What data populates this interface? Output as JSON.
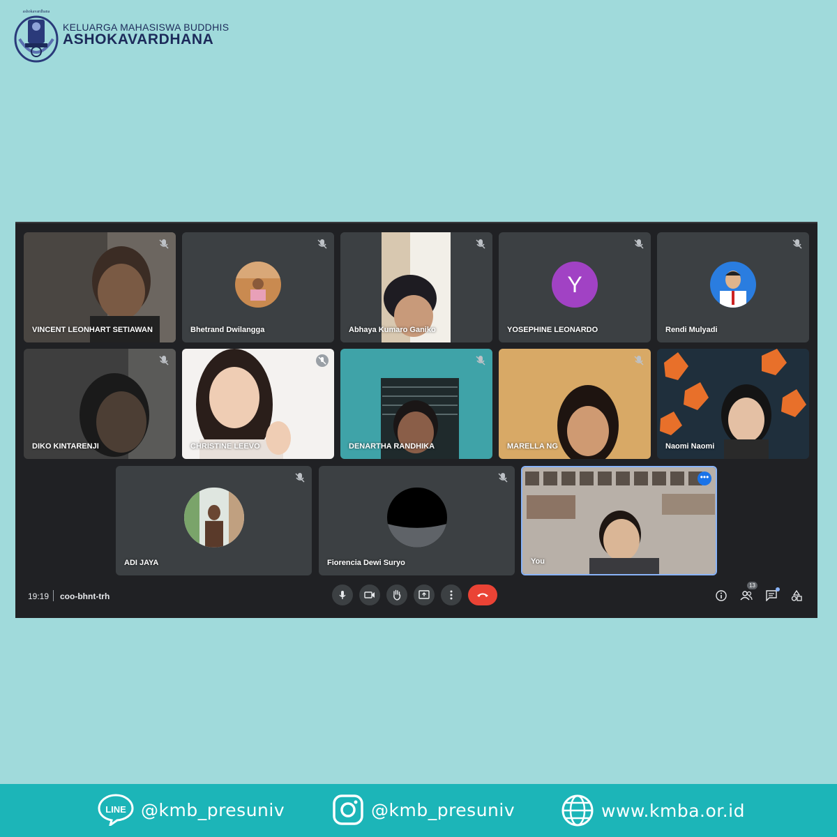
{
  "header": {
    "logo_small_text": "ashokavardhana",
    "org_line1": "KELUARGA MAHASISWA BUDDHIS",
    "org_line2": "ASHOKAVARDHANA"
  },
  "meeting": {
    "time": "19:19",
    "code": "coo-bhnt-trh",
    "participant_count": "13",
    "participants": [
      {
        "name": "VINCENT LEONHART SETIAWAN",
        "muted": true,
        "display": "video"
      },
      {
        "name": "Bhetrand Dwilangga",
        "muted": true,
        "display": "photo-avatar"
      },
      {
        "name": "Abhaya Kumaro Ganiko",
        "muted": true,
        "display": "video"
      },
      {
        "name": "YOSEPHINE LEONARDO",
        "muted": true,
        "display": "letter-avatar",
        "letter": "Y"
      },
      {
        "name": "Rendi Mulyadi",
        "muted": true,
        "display": "photo-avatar"
      },
      {
        "name": "DIKO KINTARENJI",
        "muted": true,
        "display": "video"
      },
      {
        "name": "CHRISTINE LEEVO",
        "muted": true,
        "display": "video"
      },
      {
        "name": "DENARTHA RANDHIKA",
        "muted": true,
        "display": "video"
      },
      {
        "name": "MARELLA NG",
        "muted": true,
        "display": "video"
      },
      {
        "name": "Naomi Naomi",
        "muted": false,
        "display": "video"
      },
      {
        "name": "ADI JAYA",
        "muted": true,
        "display": "photo-avatar"
      },
      {
        "name": "Fiorencia Dewi Suryo",
        "muted": true,
        "display": "photo-avatar"
      },
      {
        "name": "You",
        "muted": false,
        "display": "video"
      }
    ]
  },
  "controls": {
    "center": [
      "microphone-icon",
      "camera-icon",
      "raise-hand-icon",
      "present-icon",
      "more-options-icon",
      "hang-up-icon"
    ],
    "right": [
      "info-icon",
      "people-icon",
      "chat-icon",
      "activities-icon"
    ],
    "hangup_color": "#ea4335"
  },
  "footer": {
    "line_label": "LINE",
    "line_handle": "@kmb_presuniv",
    "instagram_handle": "@kmb_presuniv",
    "website": "www.kmba.or.id"
  },
  "colors": {
    "background": "#a0dadb",
    "footer": "#1cb5b8",
    "meet_bg": "#202124",
    "tile_bg": "#3c4043",
    "brand_text": "#1c2a5a"
  }
}
